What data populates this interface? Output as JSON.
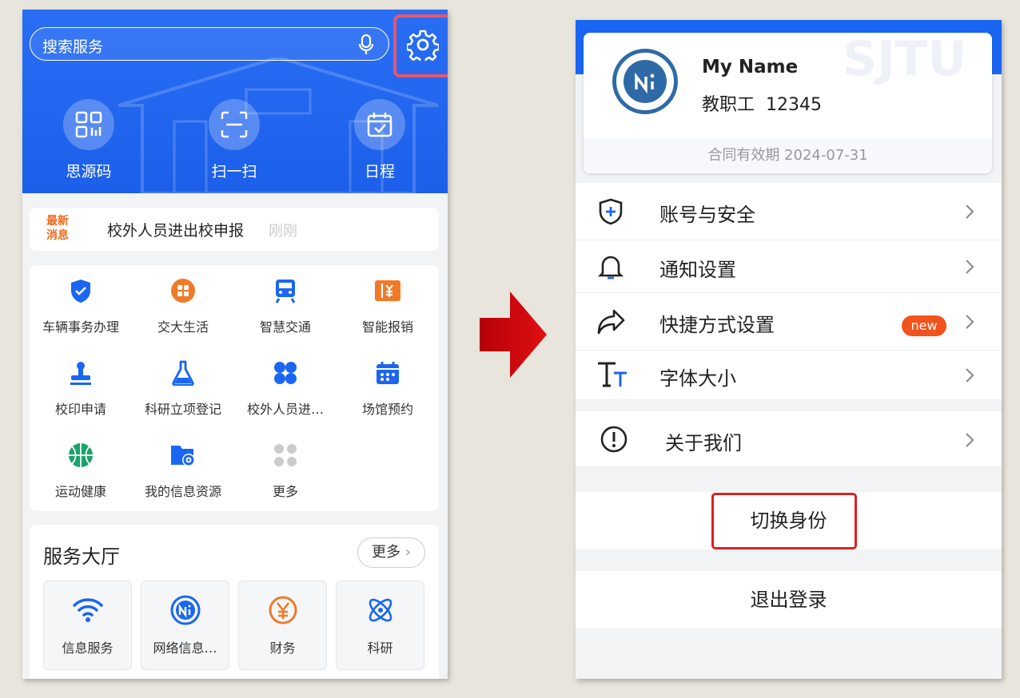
{
  "left": {
    "search_placeholder": "搜索服务",
    "quick_actions": [
      {
        "label": "思源码",
        "icon": "qr-code-icon"
      },
      {
        "label": "扫一扫",
        "icon": "scan-icon"
      },
      {
        "label": "日程",
        "icon": "calendar-icon"
      }
    ],
    "news": {
      "tag": "最新消息",
      "tag_line1": "最新",
      "tag_line2": "消息",
      "text": "校外人员进出校申报",
      "time": "刚刚"
    },
    "services": [
      {
        "label": "车辆事务办理",
        "icon": "shield-check-icon",
        "color": "#1a66f2"
      },
      {
        "label": "交大生活",
        "icon": "grid-circle-icon",
        "color": "#f07a2a"
      },
      {
        "label": "智慧交通",
        "icon": "train-icon",
        "color": "#1a66f2"
      },
      {
        "label": "智能报销",
        "icon": "invoice-icon",
        "color": "#f07a2a"
      },
      {
        "label": "校印申请",
        "icon": "stamp-icon",
        "color": "#1a66f2"
      },
      {
        "label": "科研立项登记",
        "icon": "flask-icon",
        "color": "#1a66f2"
      },
      {
        "label": "校外人员进…",
        "icon": "clover-icon",
        "color": "#1a66f2"
      },
      {
        "label": "场馆预约",
        "icon": "venue-calendar-icon",
        "color": "#1a66f2"
      },
      {
        "label": "运动健康",
        "icon": "basketball-icon",
        "color": "#1aa36a"
      },
      {
        "label": "我的信息资源",
        "icon": "folder-gear-icon",
        "color": "#1a66f2"
      },
      {
        "label": "更多",
        "icon": "more-dots-icon",
        "color": "#cccccc"
      }
    ],
    "hall": {
      "title": "服务大厅",
      "more": "更多",
      "items": [
        {
          "label": "信息服务",
          "icon": "wifi-icon"
        },
        {
          "label": "网络信息…",
          "icon": "ni-logo-icon"
        },
        {
          "label": "财务",
          "icon": "yuan-icon"
        },
        {
          "label": "科研",
          "icon": "atom-icon"
        }
      ]
    }
  },
  "right": {
    "watermark": "SJTU",
    "profile": {
      "name": "My Name",
      "role": "教职工  12345",
      "contract": "合同有效期 2024-07-31"
    },
    "menu": [
      {
        "label": "账号与安全",
        "icon": "shield-plus-icon"
      },
      {
        "label": "通知设置",
        "icon": "bell-icon"
      },
      {
        "label": "快捷方式设置",
        "icon": "share-arrow-icon",
        "badge": "new"
      },
      {
        "label": "字体大小",
        "icon": "font-size-icon"
      },
      {
        "label": "关于我们",
        "icon": "info-exclaim-icon"
      }
    ],
    "switch_identity": "切换身份",
    "logout": "退出登录"
  }
}
